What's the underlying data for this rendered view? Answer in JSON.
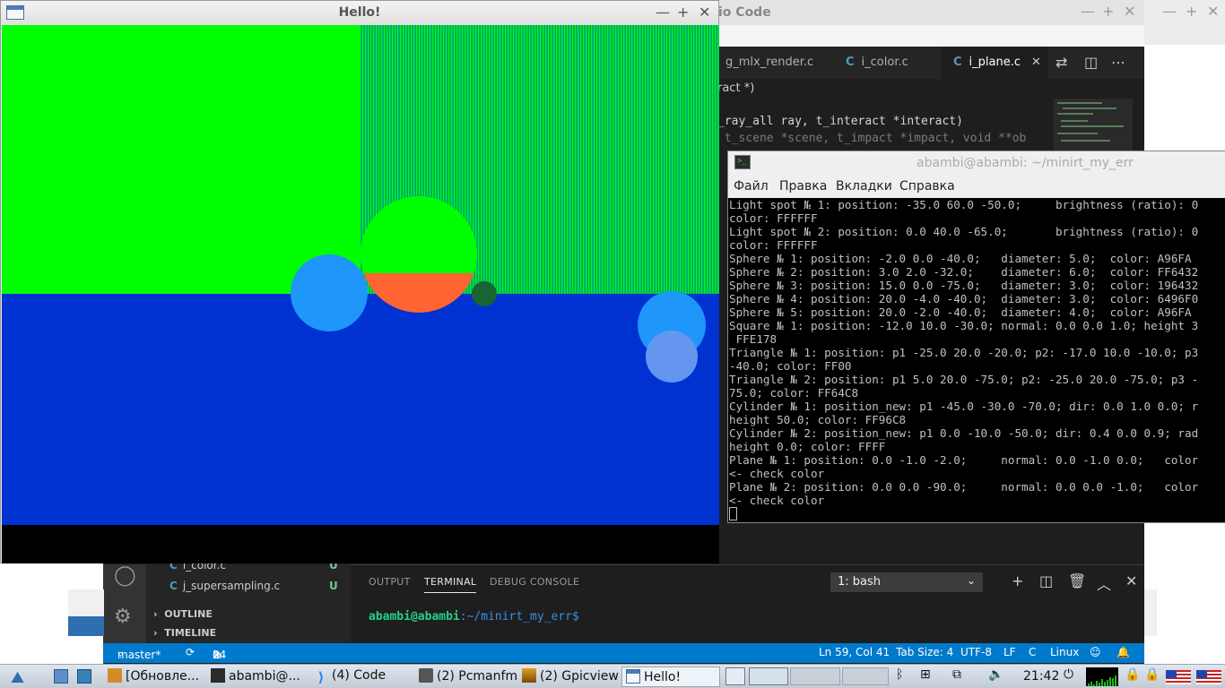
{
  "vscode": {
    "title_fragment": "io Code",
    "tabs": [
      {
        "label": "g_mlx_render.c"
      },
      {
        "label": "i_color.c"
      },
      {
        "label": "i_plane.c"
      }
    ],
    "breadcrumb": "ract *)",
    "code_lines": [
      "_ray_all ray, t_interact *interact)",
      " t_scene *scene, t_impact *impact, void **ob"
    ],
    "explorer_files": [
      {
        "name": "i_color.c",
        "status": "U"
      },
      {
        "name": "j_supersampling.c",
        "status": "U"
      }
    ],
    "sections": [
      "OUTLINE",
      "TIMELINE"
    ],
    "panel_tabs": [
      "OUTPUT",
      "TERMINAL",
      "DEBUG CONSOLE"
    ],
    "terminal_select": "1: bash",
    "prompt_user": "abambi@abambi",
    "prompt_path": ":~/minirt_my_err$",
    "status": {
      "branch": "master*",
      "errors": "24",
      "warnings": "0",
      "position": "Ln 59, Col 41",
      "tab_size": "Tab Size: 4",
      "encoding": "UTF-8",
      "eol": "LF",
      "language": "C",
      "platform": "Linux"
    }
  },
  "hello_window": {
    "title": "Hello!",
    "colors": {
      "green": "#00ff00",
      "floor_blue": "#0032d2",
      "sphere_light_blue": "#1e96fa",
      "sphere_orange": "#ff6432",
      "sphere_pale_blue": "#6496f0"
    }
  },
  "terminal_window": {
    "title": "abambi@abambi: ~/minirt_my_err",
    "menu": [
      "Файл",
      "Правка",
      "Вкладки",
      "Справка"
    ],
    "lines": [
      "Light spot № 1: position: -35.0 60.0 -50.0;     brightness (ratio): 0",
      "color: FFFFFF",
      "Light spot № 2: position: 0.0 40.0 -65.0;       brightness (ratio): 0",
      "color: FFFFFF",
      "Sphere № 1: position: -2.0 0.0 -40.0;   diameter: 5.0;  color: A96FA",
      "Sphere № 2: position: 3.0 2.0 -32.0;    diameter: 6.0;  color: FF6432",
      "Sphere № 3: position: 15.0 0.0 -75.0;   diameter: 3.0;  color: 196432",
      "Sphere № 4: position: 20.0 -4.0 -40.0;  diameter: 3.0;  color: 6496F0",
      "Sphere № 5: position: 20.0 -2.0 -40.0;  diameter: 4.0;  color: A96FA",
      "Square № 1: position: -12.0 10.0 -30.0; normal: 0.0 0.0 1.0; height 3",
      " FFE178",
      "Triangle № 1: position: p1 -25.0 20.0 -20.0; p2: -17.0 10.0 -10.0; p3",
      "-40.0; color: FF00",
      "Triangle № 2: position: p1 5.0 20.0 -75.0; p2: -25.0 20.0 -75.0; p3 -",
      "75.0; color: FF64C8",
      "Cylinder № 1: position_new: p1 -45.0 -30.0 -70.0; dir: 0.0 1.0 0.0; r",
      "height 50.0; color: FF96C8",
      "Cylinder № 2: position_new: p1 0.0 -10.0 -50.0; dir: 0.4 0.0 0.9; rad",
      "height 0.0; color: FFFF",
      "Plane № 1: position: 0.0 -1.0 -2.0;     normal: 0.0 -1.0 0.0;   color",
      "<- check color",
      "Plane № 2: position: 0.0 0.0 -90.0;     normal: 0.0 0.0 -1.0;   color",
      "<- check color"
    ]
  },
  "taskbar": {
    "tasks": [
      {
        "label": "[Обновле...",
        "icon": "package-icon"
      },
      {
        "label": "abambi@...",
        "icon": "terminal-icon"
      },
      {
        "label": "(4) Code",
        "icon": "vscode-icon"
      },
      {
        "label": "(2) Pcmanfm",
        "icon": "folder-icon"
      },
      {
        "label": "(2) Gpicview",
        "icon": "image-icon"
      },
      {
        "label": "Hello!",
        "icon": "window-icon"
      }
    ],
    "clock": "21:42"
  }
}
